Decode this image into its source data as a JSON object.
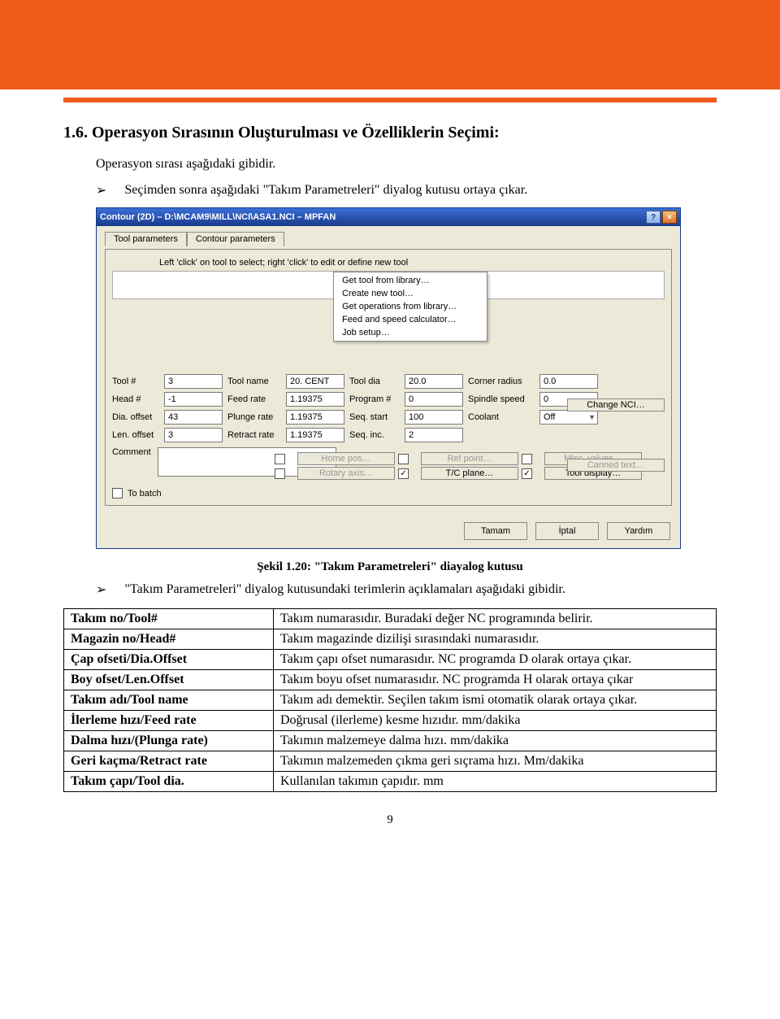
{
  "heading": "1.6. Operasyon Sırasının Oluşturulması ve Özelliklerin Seçimi:",
  "intro": "Operasyon sırası aşağıdaki gibidir.",
  "bullet1": "Seçimden sonra aşağıdaki \"Takım Parametreleri\" diyalog kutusu ortaya çıkar.",
  "dialog": {
    "title": "Contour (2D) – D:\\MCAM9\\MILL\\NCI\\ASA1.NCI – MPFAN",
    "tabs": {
      "t1": "Tool parameters",
      "t2": "Contour parameters"
    },
    "hint": "Left 'click' on tool to select; right 'click' to edit or define new tool",
    "ctxMenu": {
      "i1": "Get tool from library…",
      "i2": "Create new tool…",
      "i3": "Get operations from library…",
      "i4": "Feed and speed calculator…",
      "i5": "Job setup…"
    },
    "labels": {
      "tool_no": "Tool #",
      "tool_name": "Tool name",
      "tool_dia": "Tool dia",
      "corner_radius": "Corner radius",
      "head_no": "Head #",
      "feed_rate": "Feed rate",
      "program_no": "Program #",
      "spindle_speed": "Spindle speed",
      "dia_offset": "Dia. offset",
      "plunge_rate": "Plunge rate",
      "seq_start": "Seq. start",
      "coolant": "Coolant",
      "len_offset": "Len. offset",
      "retract_rate": "Retract rate",
      "seq_inc": "Seq. inc.",
      "comment": "Comment",
      "home_pos": "Home pos…",
      "ref_point": "Ref point…",
      "misc_values": "Misc. values…",
      "rotary_axis": "Rotary axis…",
      "tc_plane": "T/C plane…",
      "tool_display": "Tool display…",
      "to_batch": "To batch",
      "change_nci": "Change NCI…",
      "canned_text": "Canned text…"
    },
    "values": {
      "tool_no": "3",
      "tool_name": "20. CENT",
      "tool_dia": "20.0",
      "corner_radius": "0.0",
      "head_no": "-1",
      "feed_rate": "1.19375",
      "program_no": "0",
      "spindle_speed": "0",
      "dia_offset": "43",
      "plunge_rate": "1.19375",
      "seq_start": "100",
      "coolant": "Off",
      "len_offset": "3",
      "retract_rate": "1.19375",
      "seq_inc": "2"
    },
    "checks": {
      "tc_plane": "✓",
      "tool_display": "✓"
    },
    "footer": {
      "ok": "Tamam",
      "cancel": "İptal",
      "help": "Yardım"
    }
  },
  "caption": "Şekil 1.20: \"Takım Parametreleri\" diayalog kutusu",
  "bullet2": "\"Takım Parametreleri\" diyalog kutusundaki terimlerin açıklamaları aşağıdaki gibidir.",
  "table": {
    "r1": {
      "k": "Takım no/Tool#",
      "v": "Takım numarasıdır. Buradaki değer NC programında belirir."
    },
    "r2": {
      "k": "Magazin no/Head#",
      "v": "Takım magazinde dizilişi sırasındaki numarasıdır."
    },
    "r3": {
      "k": "Çap ofseti/Dia.Offset",
      "v": "Takım çapı ofset numarasıdır. NC programda D olarak ortaya çıkar."
    },
    "r4": {
      "k": "Boy ofset/Len.Offset",
      "v": "Takım boyu ofset numarasıdır. NC programda H olarak ortaya çıkar"
    },
    "r5": {
      "k": "Takım adı/Tool name",
      "v": "Takım adı demektir. Seçilen takım ismi otomatik olarak ortaya çıkar."
    },
    "r6": {
      "k": "İlerleme hızı/Feed rate",
      "v": "Doğrusal (ilerleme) kesme hızıdır. mm/dakika"
    },
    "r7": {
      "k": "Dalma hızı/(Plunga rate)",
      "v": "Takımın malzemeye dalma hızı. mm/dakika"
    },
    "r8": {
      "k": "Geri kaçma/Retract rate",
      "v": "Takımın malzemeden çıkma geri sıçrama hızı. Mm/dakika"
    },
    "r9": {
      "k": "Takım çapı/Tool dia.",
      "v": "Kullanılan takımın çapıdır. mm"
    }
  },
  "pageNumber": "9"
}
